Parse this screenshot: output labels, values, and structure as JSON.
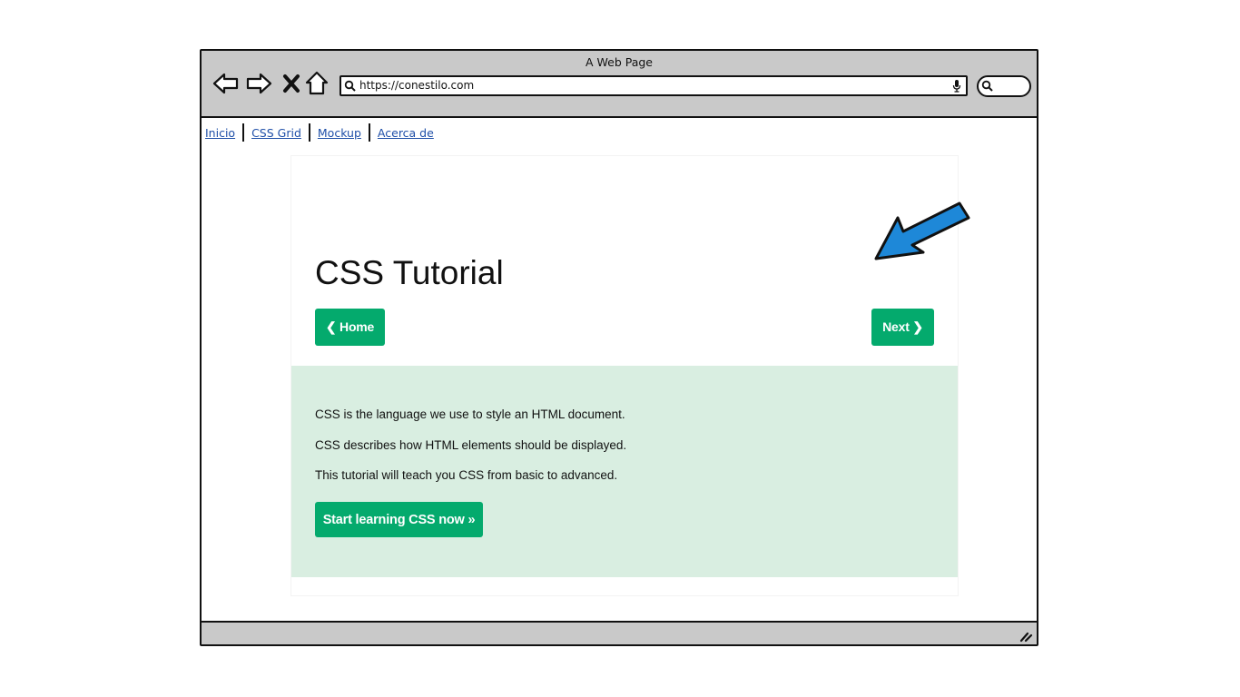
{
  "browser": {
    "window_title": "A Web Page",
    "url": "https://conestilo.com"
  },
  "icons": {
    "back": "back-arrow-icon",
    "forward": "forward-arrow-icon",
    "stop": "close-icon",
    "home": "home-icon",
    "search": "search-icon",
    "mic": "microphone-icon",
    "resize": "resize-grip-icon",
    "pointer_arrow": "arrow-icon"
  },
  "nav_links": [
    "Inicio",
    "CSS Grid",
    "Mockup",
    "Acerca de"
  ],
  "tutorial": {
    "title": "CSS Tutorial",
    "home_label": "❮ Home",
    "next_label": "Next ❯",
    "paragraphs": [
      "CSS is the language we use to style an HTML document.",
      "CSS describes how HTML elements should be displayed.",
      "This tutorial will teach you CSS from basic to advanced."
    ],
    "start_label": "Start learning CSS now »"
  },
  "colors": {
    "accent": "#04aa6d",
    "panel": "#d9eee1",
    "arrow": "#1e88d8",
    "chrome": "#c9c9c9",
    "link": "#1f4fa8"
  }
}
